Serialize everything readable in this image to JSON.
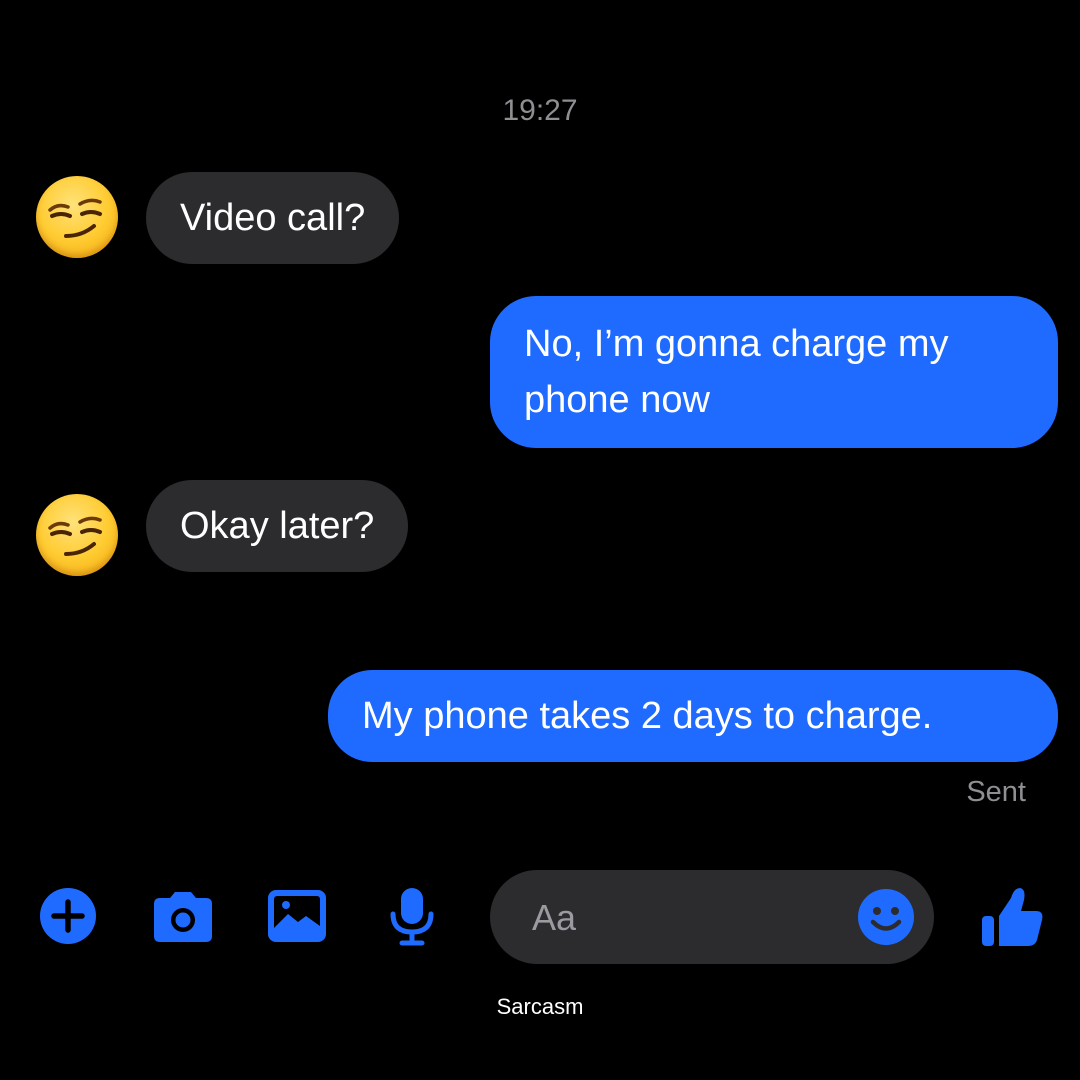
{
  "conversation": {
    "timestamp": "19:27",
    "messages": [
      {
        "sender": "contact",
        "text": "Video call?",
        "avatar_icon": "smirking-face-emoji"
      },
      {
        "sender": "me",
        "text": "No, I’m gonna charge my phone now"
      },
      {
        "sender": "contact",
        "text": "Okay later?",
        "avatar_icon": "smirking-face-emoji"
      },
      {
        "sender": "me",
        "text": "My phone takes 2 days to charge."
      }
    ],
    "status": "Sent"
  },
  "composer": {
    "placeholder": "Aa",
    "value": "",
    "actions": [
      "plus-icon",
      "camera-icon",
      "image-icon",
      "microphone-icon"
    ],
    "emoji_icon": "smiley-icon",
    "send_icon": "thumbs-up-icon"
  },
  "caption": "Sarcasm",
  "colors": {
    "background": "#000000",
    "incoming_bubble": "#2c2c2e",
    "outgoing_bubble": "#1f6bff",
    "accent": "#1f6bff",
    "muted_text": "#8e8e93"
  }
}
